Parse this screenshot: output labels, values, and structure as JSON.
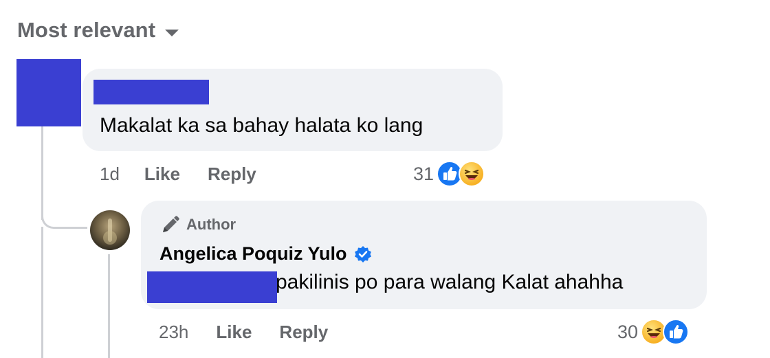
{
  "sort": {
    "label": "Most relevant"
  },
  "comment": {
    "text": "Makalat ka sa bahay halata ko lang",
    "time": "1d",
    "like_label": "Like",
    "reply_label": "Reply",
    "reaction_count": "31"
  },
  "reply": {
    "author_badge": "Author",
    "name": "Angelica Poquiz Yulo",
    "text": "pakilinis po para walang Kalat ahahha",
    "time": "23h",
    "like_label": "Like",
    "reply_label": "Reply",
    "reaction_count": "30"
  },
  "colors": {
    "redaction": "#3a3fd2",
    "bubble": "#f0f2f5",
    "like_blue": "#1877f2",
    "verified_blue": "#1877f2",
    "secondary_text": "#65676b"
  }
}
